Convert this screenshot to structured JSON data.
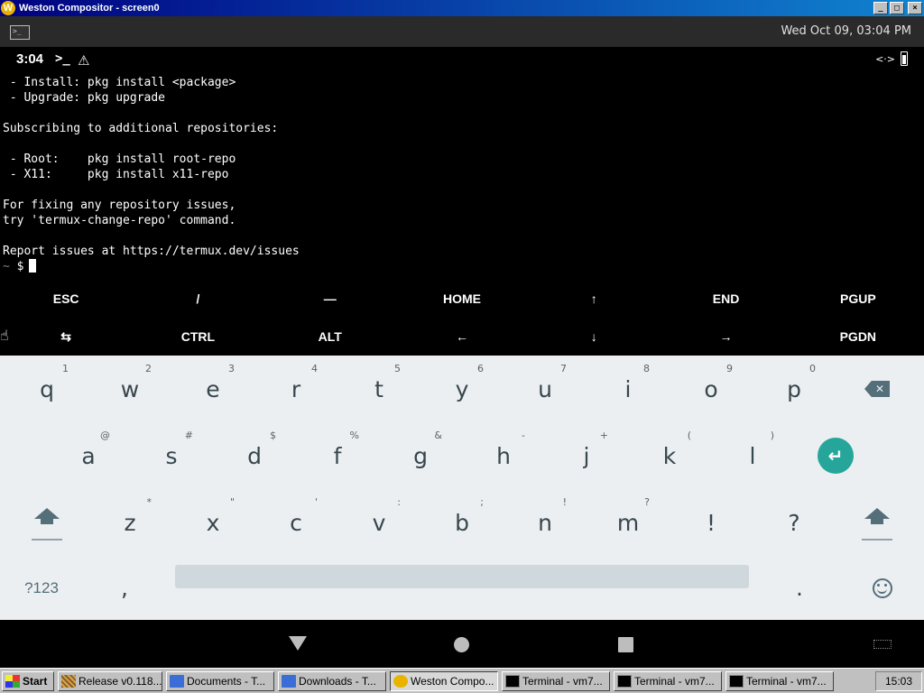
{
  "window": {
    "title": "Weston Compositor - screen0",
    "buttons": {
      "minimize": "_",
      "maximize": "□",
      "close": "×"
    }
  },
  "panel": {
    "clock": "Wed Oct 09, 03:04 PM"
  },
  "statusbar": {
    "time": "3:04",
    "prompt_icon": ">_",
    "warning_icon": "⚠",
    "link_icon": "<·>"
  },
  "terminal": {
    "lines": [
      " - Install: pkg install <package>",
      " - Upgrade: pkg upgrade",
      "",
      "Subscribing to additional repositories:",
      "",
      " - Root:    pkg install root-repo",
      " - X11:     pkg install x11-repo",
      "",
      "For fixing any repository issues,",
      "try 'termux-change-repo' command.",
      "",
      "Report issues at https://termux.dev/issues"
    ],
    "prompt_tilde": "~",
    "prompt_dollar": "$"
  },
  "extra_keys": {
    "row1": [
      "ESC",
      "/",
      "—",
      "HOME",
      "↑",
      "END",
      "PGUP"
    ],
    "row2": [
      "⇆",
      "CTRL",
      "ALT",
      "←",
      "↓",
      "→",
      "PGDN"
    ]
  },
  "keyboard": {
    "row1": [
      {
        "k": "q",
        "h": "1"
      },
      {
        "k": "w",
        "h": "2"
      },
      {
        "k": "e",
        "h": "3"
      },
      {
        "k": "r",
        "h": "4"
      },
      {
        "k": "t",
        "h": "5"
      },
      {
        "k": "y",
        "h": "6"
      },
      {
        "k": "u",
        "h": "7"
      },
      {
        "k": "i",
        "h": "8"
      },
      {
        "k": "o",
        "h": "9"
      },
      {
        "k": "p",
        "h": "0"
      }
    ],
    "row2": [
      {
        "k": "a",
        "h": "@"
      },
      {
        "k": "s",
        "h": "#"
      },
      {
        "k": "d",
        "h": "$"
      },
      {
        "k": "f",
        "h": "%"
      },
      {
        "k": "g",
        "h": "&"
      },
      {
        "k": "h",
        "h": "-"
      },
      {
        "k": "j",
        "h": "+"
      },
      {
        "k": "k",
        "h": "("
      },
      {
        "k": "l",
        "h": ")"
      }
    ],
    "row3": [
      {
        "k": "z",
        "h": "*"
      },
      {
        "k": "x",
        "h": "\""
      },
      {
        "k": "c",
        "h": "'"
      },
      {
        "k": "v",
        "h": ":"
      },
      {
        "k": "b",
        "h": ";"
      },
      {
        "k": "n",
        "h": "!"
      },
      {
        "k": "m",
        "h": "?"
      },
      {
        "k": "!",
        "h": ""
      },
      {
        "k": "?",
        "h": ""
      }
    ],
    "sym_label": "?123",
    "comma": ",",
    "period": ".",
    "backspace_glyph": "✕",
    "enter_glyph": "↵"
  },
  "taskbar": {
    "start": "Start",
    "items": [
      {
        "label": "Release v0.118....",
        "icon": "release-icon",
        "active": false
      },
      {
        "label": "Documents - T...",
        "icon": "folder-icon",
        "active": false
      },
      {
        "label": "Downloads - T...",
        "icon": "folder-icon",
        "active": false
      },
      {
        "label": "Weston Compo...",
        "icon": "weston-icon",
        "active": true
      },
      {
        "label": "Terminal - vm7...",
        "icon": "terminal-icon",
        "active": false
      },
      {
        "label": "Terminal - vm7...",
        "icon": "terminal-icon",
        "active": false
      },
      {
        "label": "Terminal - vm7...",
        "icon": "terminal-icon",
        "active": false
      }
    ],
    "clock": "15:03"
  }
}
